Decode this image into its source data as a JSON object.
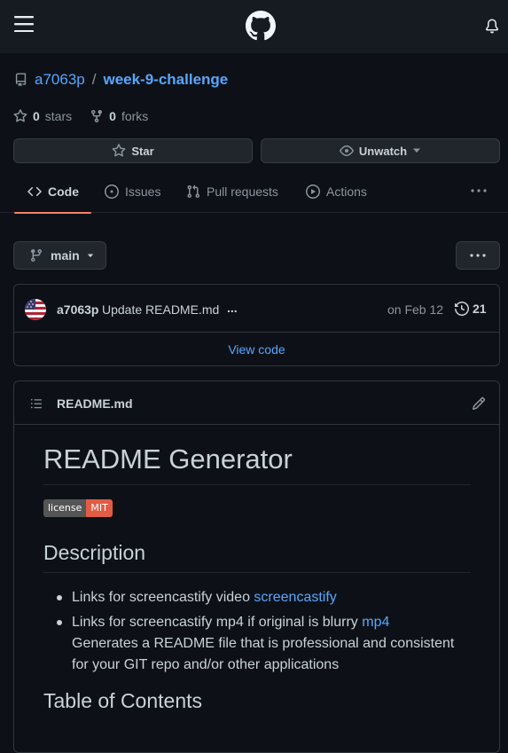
{
  "repo": {
    "owner": "a7063p",
    "separator": "/",
    "name": "week-9-challenge"
  },
  "stats": {
    "stars_count": "0",
    "stars_label": "stars",
    "forks_count": "0",
    "forks_label": "forks"
  },
  "actions": {
    "star_label": "Star",
    "watch_label": "Unwatch"
  },
  "tabs": [
    {
      "label": "Code",
      "icon": "code-icon",
      "active": true
    },
    {
      "label": "Issues",
      "icon": "issue-icon"
    },
    {
      "label": "Pull requests",
      "icon": "pull-request-icon"
    },
    {
      "label": "Actions",
      "icon": "play-icon"
    }
  ],
  "branch": {
    "name": "main"
  },
  "commit": {
    "author": "a7063p",
    "message": "Update README.md",
    "ellipsis": "...",
    "date": "on Feb 12",
    "history_count": "21",
    "view_code": "View code"
  },
  "readme": {
    "filename": "README.md",
    "title": "README Generator",
    "badge": {
      "left": "license",
      "right": "MIT"
    },
    "description_heading": "Description",
    "items": [
      {
        "text": "Links for screencastify video ",
        "link": "screencastify"
      },
      {
        "text": "Links for screencastify mp4 if original is blurry ",
        "link": "mp4",
        "extra": "Generates a README file that is professional and consistent for your GIT repo and/or other applications"
      }
    ],
    "toc_heading": "Table of Contents"
  },
  "colors": {
    "accent": "#58a6ff",
    "tab_underline": "#f78166",
    "bg": "#0d1117",
    "header_bg": "#161b22"
  }
}
